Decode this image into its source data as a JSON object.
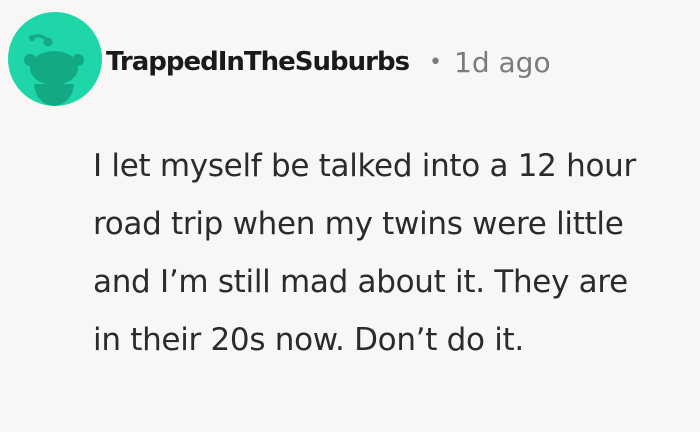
{
  "comment": {
    "username": "TrappedInTheSuburbs",
    "separator": "•",
    "timestamp": "1d ago",
    "body": "I let myself be talked into a 12 hour road trip when my twins were little and I’m still mad about it. They are in their 20s now. Don’t do it."
  },
  "avatar": {
    "icon": "reddit-snoo-icon",
    "background_color": "#1ed6a8",
    "figure_color": "#13a985"
  }
}
